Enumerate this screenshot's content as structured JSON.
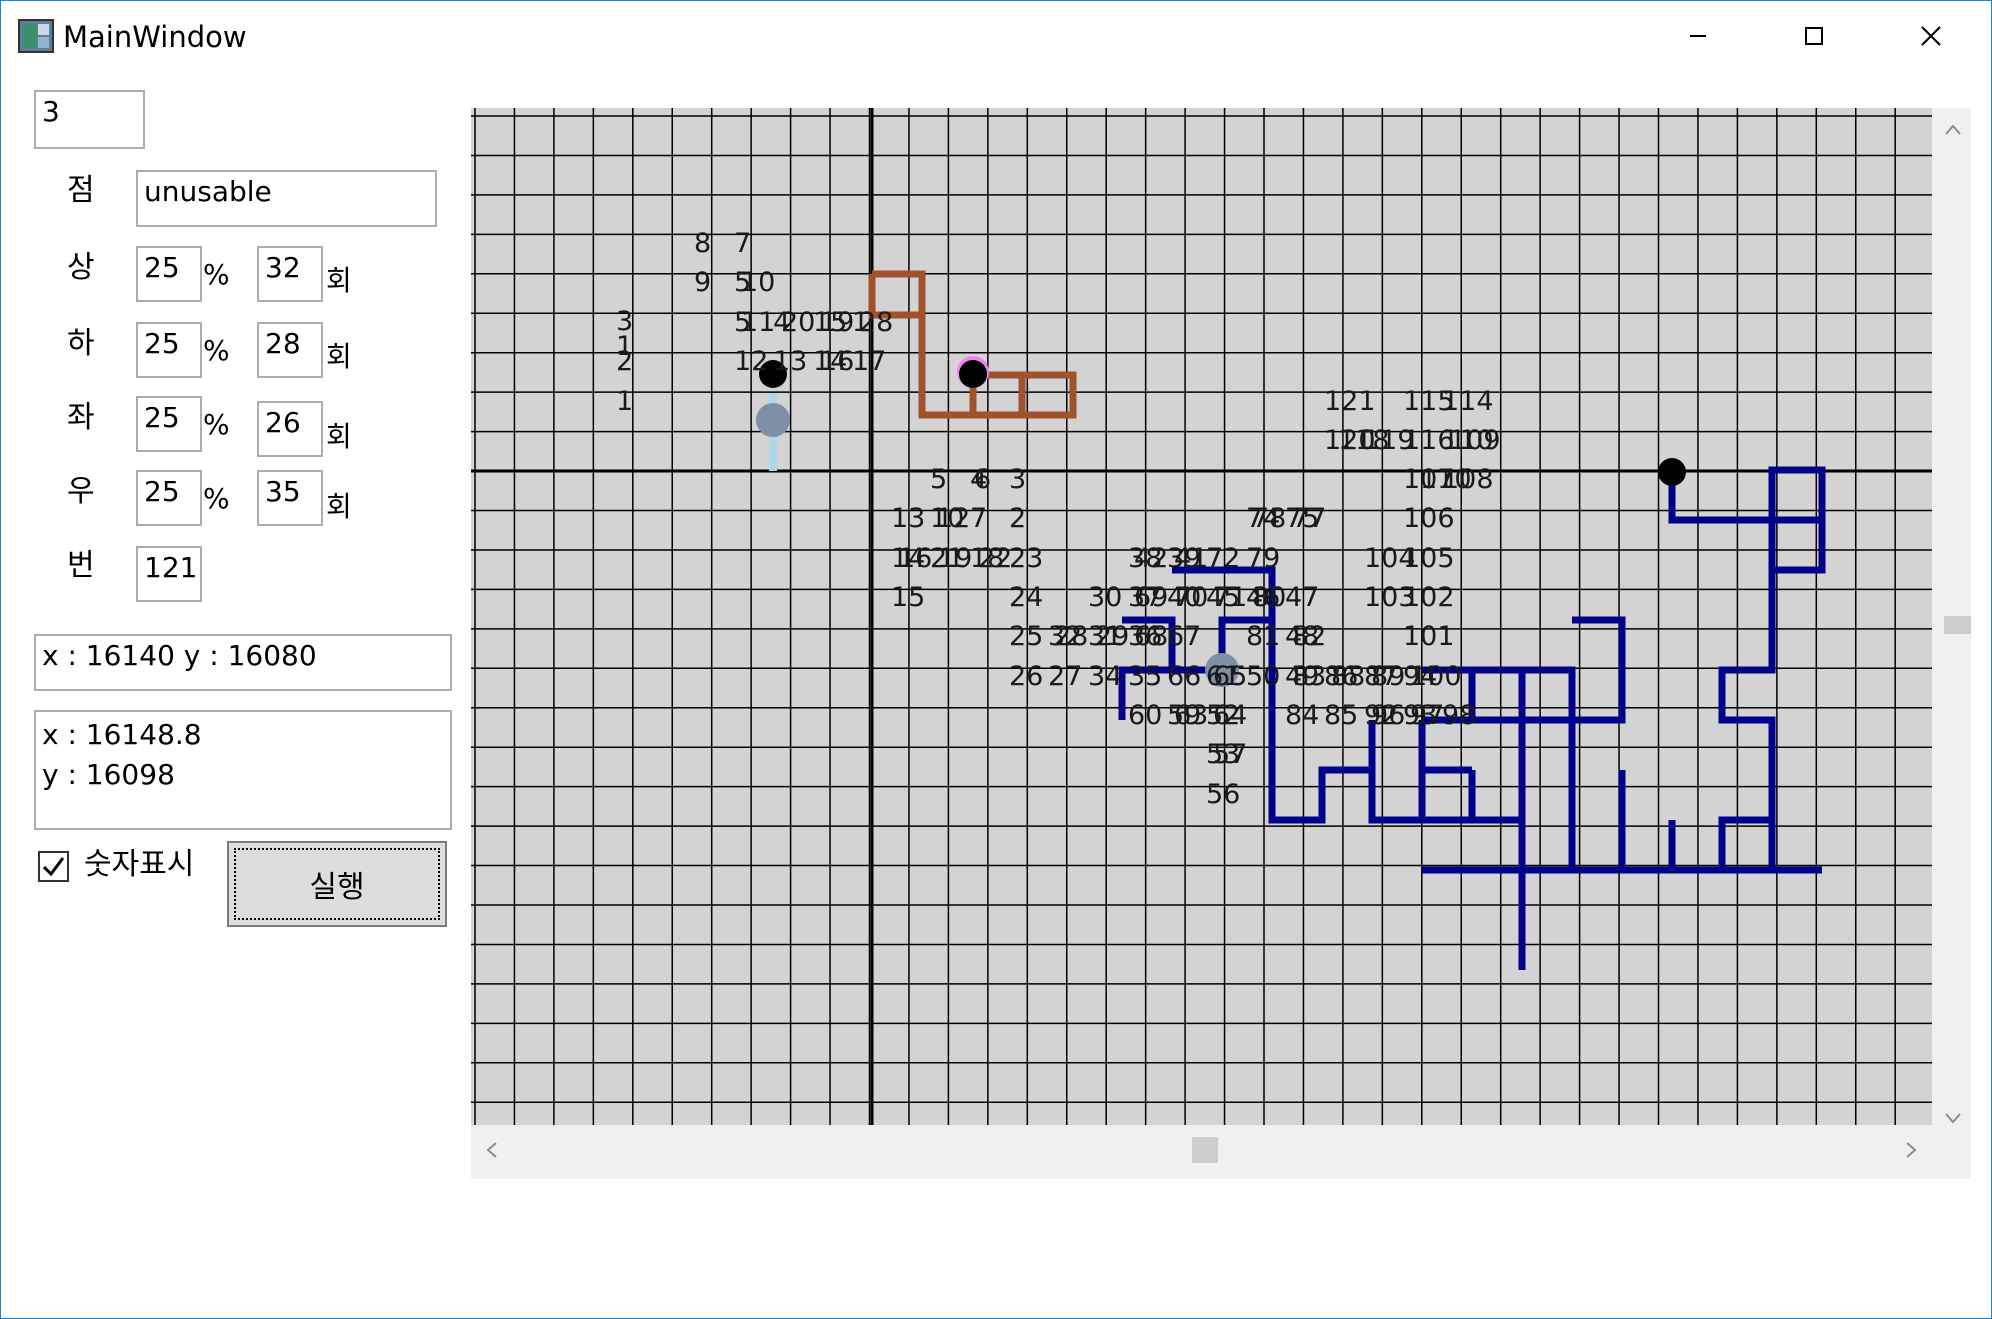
{
  "window": {
    "title": "MainWindow",
    "icon": "app-icon",
    "controls": [
      "minimize-icon",
      "maximize-icon",
      "close-icon"
    ],
    "accent_color": "#1883d7"
  },
  "form": {
    "top_value": "3",
    "point_label": "점",
    "point_value": "unusable",
    "rows": [
      {
        "label": "상",
        "percent": "25",
        "count": "32"
      },
      {
        "label": "하",
        "percent": "25",
        "count": "28"
      },
      {
        "label": "좌",
        "percent": "25",
        "count": "26"
      },
      {
        "label": "우",
        "percent": "25",
        "count": "35"
      }
    ],
    "percent_sign": "%",
    "count_unit": "회",
    "number_label": "번",
    "number_value": "121",
    "coord_text": "x : 16140 y : 16080",
    "coord_multi": "x : 16148.8\ny : 16098",
    "show_numbers_label": "숫자표시",
    "show_numbers_checked": true,
    "run_label": "실행"
  },
  "grid": {
    "background": "#d3d3d3",
    "line_color": "#000000",
    "blue_path_color": "#00008b",
    "brown_path_color": "#a0522d",
    "lightblue_path_color": "#add8e6",
    "labels": [
      [
        "3",
        608,
        316
      ],
      [
        "1",
        608,
        341
      ],
      [
        "2",
        608,
        356
      ],
      [
        "1",
        608,
        396
      ],
      [
        "8",
        686,
        238
      ],
      [
        "7",
        726,
        238
      ],
      [
        "9",
        686,
        277
      ],
      [
        "5",
        726,
        277
      ],
      [
        "10",
        733,
        277
      ],
      [
        "5",
        726,
        317
      ],
      [
        "11",
        733,
        317
      ],
      [
        "4",
        765,
        317
      ],
      [
        "20",
        773,
        317
      ],
      [
        "15",
        805,
        317
      ],
      [
        "19",
        812,
        317
      ],
      [
        "1",
        844,
        317
      ],
      [
        "28",
        851,
        317
      ],
      [
        "12",
        726,
        356
      ],
      [
        "13",
        765,
        356
      ],
      [
        "14",
        805,
        356
      ],
      [
        "16",
        812,
        356
      ],
      [
        "17",
        844,
        356
      ],
      [
        "121",
        1316,
        396
      ],
      [
        "115",
        1395,
        396
      ],
      [
        "114",
        1434,
        396
      ],
      [
        "120",
        1316,
        435
      ],
      [
        "118",
        1330,
        435
      ],
      [
        "119",
        1355,
        435
      ],
      [
        "116",
        1395,
        435
      ],
      [
        "110",
        1434,
        435
      ],
      [
        "109",
        1441,
        435
      ],
      [
        "107",
        1395,
        474
      ],
      [
        "110",
        1412,
        474
      ],
      [
        "108",
        1434,
        474
      ],
      [
        "5",
        922,
        474
      ],
      [
        "4",
        962,
        474
      ],
      [
        "6",
        966,
        474
      ],
      [
        "3",
        1001,
        474
      ],
      [
        "13",
        883,
        513
      ],
      [
        "10",
        922,
        513
      ],
      [
        "12",
        928,
        513
      ],
      [
        "7",
        962,
        513
      ],
      [
        "2",
        1001,
        513
      ],
      [
        "74",
        1238,
        513
      ],
      [
        "78",
        1244,
        513
      ],
      [
        "75",
        1277,
        513
      ],
      [
        "77",
        1284,
        513
      ],
      [
        "106",
        1395,
        513
      ],
      [
        "14",
        883,
        553
      ],
      [
        "16",
        890,
        553
      ],
      [
        "21",
        922,
        553
      ],
      [
        "19",
        930,
        553
      ],
      [
        "18",
        962,
        553
      ],
      [
        "22",
        970,
        553
      ],
      [
        "23",
        1001,
        553
      ],
      [
        "38",
        1120,
        553
      ],
      [
        "42",
        1126,
        553
      ],
      [
        "39",
        1159,
        553
      ],
      [
        "41",
        1166,
        553
      ],
      [
        "72",
        1198,
        553
      ],
      [
        "79",
        1238,
        553
      ],
      [
        "104",
        1356,
        553
      ],
      [
        "105",
        1395,
        553
      ],
      [
        "15",
        883,
        592
      ],
      [
        "24",
        1001,
        592
      ],
      [
        "30",
        1080,
        592
      ],
      [
        "37",
        1120,
        592
      ],
      [
        "69",
        1126,
        592
      ],
      [
        "40",
        1159,
        592
      ],
      [
        "70",
        1166,
        592
      ],
      [
        "45",
        1198,
        592
      ],
      [
        "71",
        1205,
        592
      ],
      [
        "46",
        1238,
        592
      ],
      [
        "80",
        1244,
        592
      ],
      [
        "47",
        1277,
        592
      ],
      [
        "103",
        1356,
        592
      ],
      [
        "102",
        1395,
        592
      ],
      [
        "25",
        1001,
        631
      ],
      [
        "32",
        1040,
        631
      ],
      [
        "28",
        1046,
        631
      ],
      [
        "31",
        1080,
        631
      ],
      [
        "29",
        1087,
        631
      ],
      [
        "36",
        1120,
        631
      ],
      [
        "68",
        1126,
        631
      ],
      [
        "67",
        1159,
        631
      ],
      [
        "81",
        1238,
        631
      ],
      [
        "48",
        1277,
        631
      ],
      [
        "82",
        1284,
        631
      ],
      [
        "101",
        1395,
        631
      ],
      [
        "26",
        1001,
        671
      ],
      [
        "27",
        1040,
        671
      ],
      [
        "34",
        1080,
        671
      ],
      [
        "35",
        1120,
        671
      ],
      [
        "66",
        1159,
        671
      ],
      [
        "61",
        1198,
        671
      ],
      [
        "65",
        1205,
        671
      ],
      [
        "50",
        1238,
        671
      ],
      [
        "49",
        1277,
        671
      ],
      [
        "83",
        1284,
        671
      ],
      [
        "86",
        1316,
        671
      ],
      [
        "88",
        1323,
        671
      ],
      [
        "87",
        1356,
        671
      ],
      [
        "89",
        1363,
        671
      ],
      [
        "94",
        1395,
        671
      ],
      [
        "100",
        1402,
        671
      ],
      [
        "60",
        1120,
        710
      ],
      [
        "59",
        1159,
        710
      ],
      [
        "63",
        1166,
        710
      ],
      [
        "52",
        1198,
        710
      ],
      [
        "64",
        1205,
        710
      ],
      [
        "84",
        1277,
        710
      ],
      [
        "85",
        1316,
        710
      ],
      [
        "92",
        1356,
        710
      ],
      [
        "96",
        1363,
        710
      ],
      [
        "93",
        1395,
        710
      ],
      [
        "97",
        1402,
        710
      ],
      [
        "98",
        1434,
        710
      ],
      [
        "53",
        1198,
        749
      ],
      [
        "57",
        1205,
        749
      ],
      [
        "56",
        1198,
        789
      ]
    ]
  },
  "scrollbars": {
    "up_icon": "chevron-up-icon",
    "down_icon": "chevron-down-icon",
    "left_icon": "chevron-left-icon",
    "right_icon": "chevron-right-icon"
  }
}
